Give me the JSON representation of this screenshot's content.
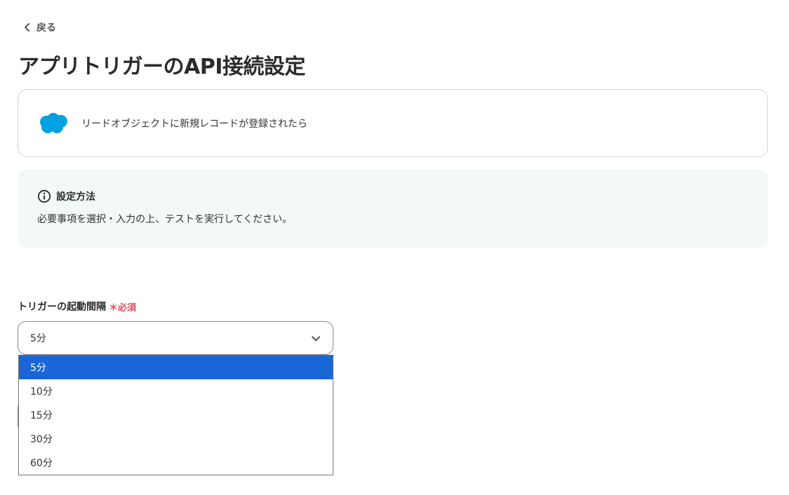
{
  "back": {
    "label": "戻る"
  },
  "title": "アプリトリガーのAPI接続設定",
  "app_card": {
    "icon": "salesforce-cloud-icon",
    "trigger_text": "リードオブジェクトに新規レコードが登録されたら"
  },
  "info": {
    "icon": "info-icon",
    "heading": "設定方法",
    "body": "必要事項を選択・入力の上、テストを実行してください。"
  },
  "interval_field": {
    "label": "トリガーの起動間隔",
    "required_label": "＊必須",
    "selected": "5分",
    "options": [
      "5分",
      "10分",
      "15分",
      "30分",
      "60分"
    ],
    "selected_index": 0
  },
  "colors": {
    "accent": "#1a66d6",
    "required": "#e04b5a",
    "info_bg": "#f2f9f8",
    "salesforce": "#00a1e0"
  }
}
